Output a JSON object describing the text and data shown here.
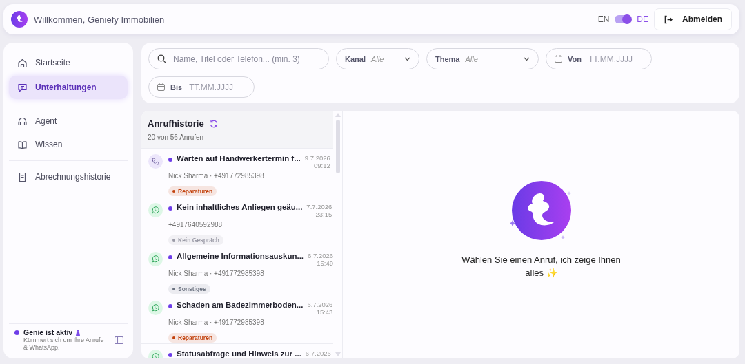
{
  "header": {
    "welcome": "Willkommen, Geniefy Immobilien",
    "language_toggle": {
      "left": "EN",
      "right": "DE",
      "on": true
    },
    "logout": "Abmelden"
  },
  "sidebar": {
    "groups": [
      [
        {
          "label": "Startseite",
          "selected": false
        },
        {
          "label": "Unterhaltungen",
          "selected": true
        }
      ],
      [
        {
          "label": "Agent",
          "selected": false
        },
        {
          "label": "Wissen",
          "selected": false
        }
      ],
      [
        {
          "label": "Abrechnungshistorie",
          "selected": false
        }
      ]
    ],
    "status": {
      "title": "Genie ist aktiv",
      "text": "Kümmert sich um Ihre Anrufe & WhatsApp."
    }
  },
  "filters": {
    "search": {
      "placeholder": "Name, Titel oder Telefon... (min. 3)"
    },
    "selects": [
      {
        "label": "Kanal",
        "value": "Alle"
      },
      {
        "label": "Thema",
        "value": "Alle"
      }
    ],
    "dates": [
      {
        "label": "Von",
        "placeholder": "TT.MM.JJJJ"
      },
      {
        "label": "Bis",
        "placeholder": "TT.MM.JJJJ"
      }
    ]
  },
  "call_list": {
    "title": "Anrufhistorie",
    "count": "20 von 56 Anrufen",
    "items": [
      {
        "kind": "phone",
        "title": "Warten auf Handwerkertermin f...",
        "caller": "Nick Sharma · +491772985398",
        "date": "9.7.2026",
        "time": "09:12",
        "tag": "Reparaturen",
        "color": "#c2410c"
      },
      {
        "kind": "whatsapp",
        "title": "Kein inhaltliches Anliegen geäu...",
        "caller": "+4917640592988",
        "date": "7.7.2026",
        "time": "23:15",
        "tag": "Kein Gespräch",
        "color": "#9a9aa6"
      },
      {
        "kind": "whatsapp",
        "title": "Allgemeine Informationsauskun...",
        "caller": "Nick Sharma · +491772985398",
        "date": "6.7.2026",
        "time": "15:49",
        "tag": "Sonstiges",
        "color": "#6b7280"
      },
      {
        "kind": "whatsapp",
        "title": "Schaden am Badezimmerboden...",
        "caller": "Nick Sharma · +491772985398",
        "date": "6.7.2026",
        "time": "15:43",
        "tag": "Reparaturen",
        "color": "#c2410c"
      },
      {
        "kind": "whatsapp",
        "title": "Statusabfrage und Hinweis zur ...",
        "date": "6.7.2026"
      }
    ]
  },
  "detail": {
    "empty_text": "Wählen Sie einen Anruf, ich zeige Ihnen alles ✨"
  }
}
